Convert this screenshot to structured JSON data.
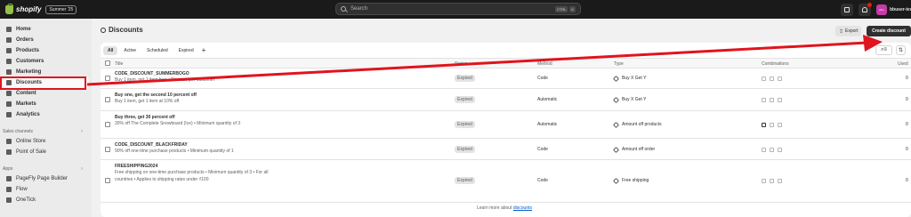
{
  "topbar": {
    "brand": "shopify",
    "edition": "Summer '25",
    "search_placeholder": "Search",
    "shortcut_keys": [
      "CTRL",
      "K"
    ],
    "user_initials": "bbu",
    "user_name": "bbuser-test"
  },
  "sidebar": {
    "items": [
      {
        "label": "Home",
        "icon": "home-icon"
      },
      {
        "label": "Orders",
        "icon": "orders-icon"
      },
      {
        "label": "Products",
        "icon": "products-icon"
      },
      {
        "label": "Customers",
        "icon": "customers-icon"
      },
      {
        "label": "Marketing",
        "icon": "marketing-icon"
      },
      {
        "label": "Discounts",
        "icon": "discounts-icon"
      },
      {
        "label": "Content",
        "icon": "content-icon"
      },
      {
        "label": "Markets",
        "icon": "markets-icon"
      },
      {
        "label": "Analytics",
        "icon": "analytics-icon"
      }
    ],
    "sales_channels_label": "Sales channels",
    "sales_channels": [
      {
        "label": "Online Store"
      },
      {
        "label": "Point of Sale"
      }
    ],
    "apps_label": "Apps",
    "apps": [
      {
        "label": "PageFly Page Builder"
      },
      {
        "label": "Flow"
      },
      {
        "label": "OneTick"
      }
    ]
  },
  "page": {
    "title": "Discounts",
    "export_label": "Export",
    "create_label": "Create discount",
    "tabs": [
      "All",
      "Active",
      "Scheduled",
      "Expired"
    ],
    "add_tab": "+"
  },
  "table": {
    "headers": {
      "title": "Title",
      "status": "Status",
      "method": "Method",
      "type": "Type",
      "combinations": "Combinations",
      "used": "Used"
    },
    "rows": [
      {
        "title": "CODE_DISCOUNT_SUMMERBOGO",
        "desc": "Buy 1 item, get 1 item free • One use per customer",
        "status": "Expired",
        "method": "Code",
        "type": "Buy X Get Y",
        "used": "0"
      },
      {
        "title": "Buy one, get the second 10 percent off",
        "desc": "Buy 1 item, get 1 item at 10% off",
        "status": "Expired",
        "method": "Automatic",
        "type": "Buy X Get Y",
        "used": "0"
      },
      {
        "title": "Buy three, get 30 percent off",
        "desc": "30% off The Complete Snowboard (Ice) • Minimum quantity of 3",
        "status": "Expired",
        "method": "Automatic",
        "type": "Amount off products",
        "used": "0"
      },
      {
        "title": "CODE_DISCOUNT_BLACKFRIDAY",
        "desc": "90% off one-time purchase products • Minimum quantity of 1",
        "status": "Expired",
        "method": "Code",
        "type": "Amount off order",
        "used": "0"
      },
      {
        "title": "FREESHIPPING2024",
        "desc": "Free shipping on one-time purchase products • Minimum quantity of 3 • For all countries • Applies to shipping rates under ₫100",
        "status": "Expired",
        "method": "Code",
        "type": "Free shipping",
        "used": "0"
      }
    ]
  },
  "footer": {
    "text": "Learn more about",
    "link": "discounts"
  },
  "colors": {
    "annotation_red": "#e0141e",
    "topbar_bg": "#1a1a1a",
    "link_blue": "#005bd3"
  }
}
